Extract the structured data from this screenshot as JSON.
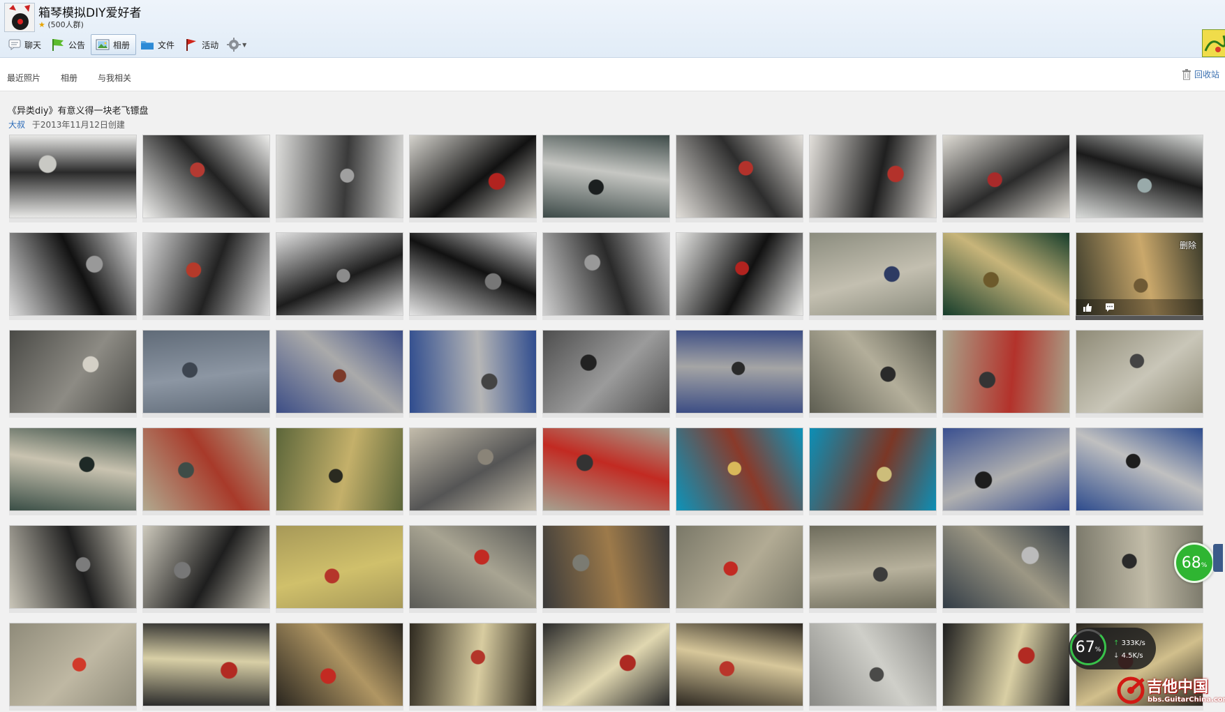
{
  "header": {
    "group_name": "箱琴模拟DIY爱好者",
    "group_size": "(500人群)",
    "tabs": [
      {
        "label": "聊天",
        "icon": "chat-bubble-icon"
      },
      {
        "label": "公告",
        "icon": "announcement-flag-icon"
      },
      {
        "label": "相册",
        "icon": "photo-album-icon",
        "active": true
      },
      {
        "label": "文件",
        "icon": "folder-icon"
      },
      {
        "label": "活动",
        "icon": "red-flag-icon"
      }
    ],
    "settings_icon": "gear-icon"
  },
  "subnav": {
    "items": [
      "最近照片",
      "相册",
      "与我相关"
    ],
    "recycle_label": "回收站"
  },
  "album": {
    "title": "《异类diy》有意义得一块老飞镖盘",
    "author": "大叔",
    "created": "于2013年11月12日创建"
  },
  "photo_overlay": {
    "delete_label": "删除"
  },
  "photos": [
    {
      "subject": "flights-sketches",
      "colors": [
        "#e8e8e6",
        "#2a2a2a",
        "#c9c9c4"
      ]
    },
    {
      "subject": "flights-markers",
      "colors": [
        "#efefed",
        "#222",
        "#b43a32"
      ]
    },
    {
      "subject": "hex-cutting-mat",
      "colors": [
        "#dcdcda",
        "#3a3a3a",
        "#a0a0a0"
      ]
    },
    {
      "subject": "ruler-heart-flight",
      "colors": [
        "#d4d2cc",
        "#111",
        "#b1231f"
      ]
    },
    {
      "subject": "ruler-light-flights",
      "colors": [
        "#3d4a48",
        "#c6c7c3",
        "#1b1f1f"
      ]
    },
    {
      "subject": "flights-markers-2",
      "colors": [
        "#e2dfda",
        "#2d2d2d",
        "#b3322b"
      ]
    },
    {
      "subject": "flights-markers-3",
      "colors": [
        "#e2dfda",
        "#1f1f1f",
        "#b3322b"
      ]
    },
    {
      "subject": "flights-pens",
      "colors": [
        "#dedbd4",
        "#2b2b2b",
        "#a82a2a"
      ]
    },
    {
      "subject": "hex-flights",
      "colors": [
        "#dadcda",
        "#1a1a1a",
        "#9aa"
      ]
    },
    {
      "subject": "black-flights",
      "colors": [
        "#ddd",
        "#111",
        "#999"
      ]
    },
    {
      "subject": "dart-red-shaft",
      "colors": [
        "#d9d9d9",
        "#222",
        "#b53a2a"
      ]
    },
    {
      "subject": "darts-hex-mat",
      "colors": [
        "#e1e1e1",
        "#1c1c1c",
        "#8c8c8c"
      ]
    },
    {
      "subject": "flights-white-grid",
      "colors": [
        "#e4e4e4",
        "#111",
        "#777"
      ]
    },
    {
      "subject": "flight-cut-tool",
      "colors": [
        "#cfcfcf",
        "#2a2a2a",
        "#999"
      ]
    },
    {
      "subject": "flights-sketch-2",
      "colors": [
        "#e8e8e6",
        "#111",
        "#b1231f"
      ]
    },
    {
      "subject": "board-surface",
      "colors": [
        "#8b8c7e",
        "#c3bfb0",
        "#2d3b63"
      ]
    },
    {
      "subject": "board-on-green",
      "colors": [
        "#163d2b",
        "#c8b57a",
        "#6d5a2b"
      ]
    },
    {
      "subject": "board-closeup",
      "colors": [
        "#3a3a2a",
        "#caa86b",
        "#6f5a35"
      ],
      "hovered": true
    },
    {
      "subject": "file-tube",
      "colors": [
        "#4a4a46",
        "#8d8b84",
        "#d4d0c6"
      ]
    },
    {
      "subject": "metal-tube",
      "colors": [
        "#606b78",
        "#8c96a3",
        "#3d4550"
      ]
    },
    {
      "subject": "vise-tube",
      "colors": [
        "#3d4e86",
        "#aaa",
        "#7b3a2a"
      ]
    },
    {
      "subject": "vise-pipe",
      "colors": [
        "#2f4c8e",
        "#b6b6b6",
        "#444"
      ]
    },
    {
      "subject": "grinder-ring",
      "colors": [
        "#4e4e4e",
        "#9b9b9b",
        "#222"
      ]
    },
    {
      "subject": "vise-ring",
      "colors": [
        "#3c4d84",
        "#a5a5a5",
        "#2a2a2a"
      ]
    },
    {
      "subject": "rings-on-board",
      "colors": [
        "#5e5e52",
        "#b3ae9a",
        "#2a2a2a"
      ]
    },
    {
      "subject": "marker-board",
      "colors": [
        "#a9a28a",
        "#b3322b",
        "#343434"
      ]
    },
    {
      "subject": "blade-board",
      "colors": [
        "#8e8a76",
        "#c9c6b8",
        "#444"
      ]
    },
    {
      "subject": "board-edge-saw",
      "colors": [
        "#3a4e46",
        "#c9c3b0",
        "#1e2926"
      ]
    },
    {
      "subject": "board-edge-knife",
      "colors": [
        "#b1a98f",
        "#a83a2a",
        "#3f4c47"
      ]
    },
    {
      "subject": "board-clamp",
      "colors": [
        "#5c663a",
        "#c4b06a",
        "#2a2a20"
      ]
    },
    {
      "subject": "wood-pipe-ring",
      "colors": [
        "#c3bcab",
        "#555",
        "#8a8478"
      ]
    },
    {
      "subject": "board-red-target",
      "colors": [
        "#a6a190",
        "#c22a22",
        "#333"
      ]
    },
    {
      "subject": "red-block-rings",
      "colors": [
        "#0d93b9",
        "#8a3a2a",
        "#d9b85a"
      ]
    },
    {
      "subject": "red-block-rings-2",
      "colors": [
        "#0c8fb6",
        "#7b3726",
        "#cdbd7a"
      ]
    },
    {
      "subject": "saw-vise",
      "colors": [
        "#3a5090",
        "#b0b0b0",
        "#1d1d1d"
      ]
    },
    {
      "subject": "vise-grinder",
      "colors": [
        "#2e4c8d",
        "#c0c0c0",
        "#1e1e1e"
      ]
    },
    {
      "subject": "ring-grinder-wood",
      "colors": [
        "#c9c5b8",
        "#1e1e1e",
        "#7c7c7c"
      ]
    },
    {
      "subject": "ring-grinder-wood-2",
      "colors": [
        "#cdc9bc",
        "#1e1e1e",
        "#777"
      ]
    },
    {
      "subject": "ring-on-board-yellow",
      "colors": [
        "#a79958",
        "#d0c06b",
        "#b5352a"
      ]
    },
    {
      "subject": "weight-board",
      "colors": [
        "#5a5a56",
        "#a8a492",
        "#c22a22"
      ]
    },
    {
      "subject": "weight-hammer",
      "colors": [
        "#3a3a3a",
        "#9d7a4a",
        "#7b7b72"
      ]
    },
    {
      "subject": "board-red-center",
      "colors": [
        "#7a7868",
        "#b2ab94",
        "#c22a22"
      ]
    },
    {
      "subject": "board-wires",
      "colors": [
        "#6e6c5c",
        "#b7b19c",
        "#3b3b3b"
      ]
    },
    {
      "subject": "board-wires-top",
      "colors": [
        "#323c46",
        "#9c9784",
        "#bbb"
      ]
    },
    {
      "subject": "board-numbers",
      "colors": [
        "#7a786a",
        "#c2bca8",
        "#2a2a2a"
      ]
    },
    {
      "subject": "board-wires-2",
      "colors": [
        "#8f8b7a",
        "#bfb8a3",
        "#d13a2a"
      ]
    },
    {
      "subject": "dartboard-full",
      "colors": [
        "#2b2b2b",
        "#d8cfa6",
        "#b22a22"
      ]
    },
    {
      "subject": "bull-closeup",
      "colors": [
        "#2a261f",
        "#b09663",
        "#c32a22"
      ]
    },
    {
      "subject": "bull-wires",
      "colors": [
        "#2f2a20",
        "#d8cca0",
        "#b3352a"
      ]
    },
    {
      "subject": "dartboard-full-2",
      "colors": [
        "#2a2a2a",
        "#e0d7b0",
        "#ad2a22"
      ]
    },
    {
      "subject": "bull-rings",
      "colors": [
        "#2d2821",
        "#d7c79a",
        "#b9352a"
      ]
    },
    {
      "subject": "staples-pile",
      "colors": [
        "#8a8a86",
        "#cfcfc9",
        "#4a4a48"
      ]
    },
    {
      "subject": "board-clear-box",
      "colors": [
        "#1f1f1f",
        "#d9cfa4",
        "#b22a22"
      ]
    },
    {
      "subject": "bull-closeup-2",
      "colors": [
        "#2a261f",
        "#d1bf8c",
        "#c22a22"
      ]
    }
  ],
  "speed_badge": {
    "value": "68",
    "unit": "%"
  },
  "monitor": {
    "value": "67",
    "unit": "%",
    "upload": "333",
    "upload_unit": "K/s",
    "download": "4.5",
    "download_unit": "K/s"
  },
  "watermark": {
    "title": "吉他中国",
    "url": "bbs.GuitarChina.com"
  }
}
